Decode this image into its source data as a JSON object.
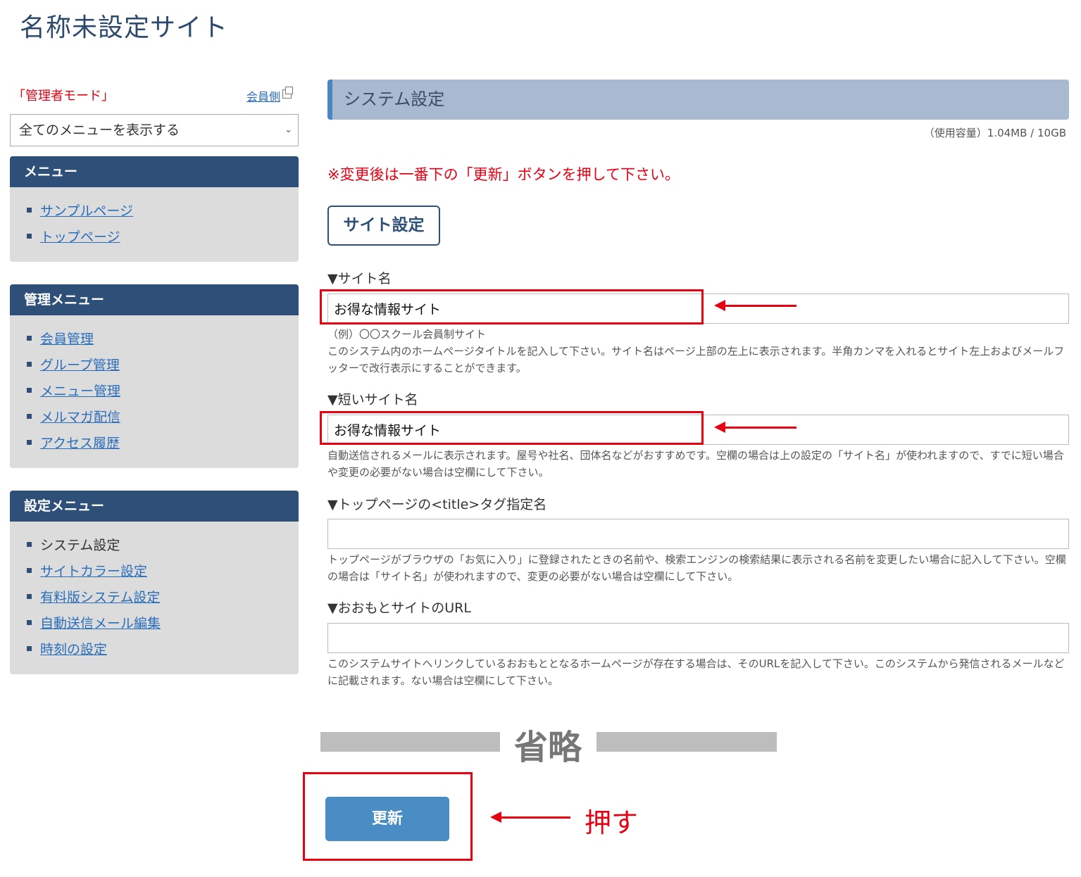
{
  "header": {
    "site_title": "名称未設定サイト"
  },
  "sidebar": {
    "admin_mode": "「管理者モード」",
    "member_link": "会員側",
    "menu_select_value": "全てのメニューを表示する",
    "menu": {
      "title": "メニュー",
      "items": [
        "サンプルページ",
        "トップページ"
      ]
    },
    "admin_menu": {
      "title": "管理メニュー",
      "items": [
        "会員管理",
        "グループ管理",
        "メニュー管理",
        "メルマガ配信",
        "アクセス履歴"
      ]
    },
    "settings_menu": {
      "title": "設定メニュー",
      "current": "システム設定",
      "items": [
        "サイトカラー設定",
        "有料版システム設定",
        "自動送信メール編集",
        "時刻の設定"
      ]
    }
  },
  "main": {
    "section_title": "システム設定",
    "usage": "（使用容量）1.04MB / 10GB",
    "notice": "※変更後は一番下の「更新」ボタンを押して下さい。",
    "tab_label": "サイト設定",
    "fields": {
      "site_name": {
        "label": "▼サイト名",
        "value": "お得な情報サイト",
        "example": "（例）〇〇スクール会員制サイト",
        "help": "このシステム内のホームページタイトルを記入して下さい。サイト名はページ上部の左上に表示されます。半角カンマを入れるとサイト左上およびメールフッターで改行表示にすることができます。"
      },
      "short_name": {
        "label": "▼短いサイト名",
        "value": "お得な情報サイト",
        "help": "自動送信されるメールに表示されます。屋号や社名、団体名などがおすすめです。空欄の場合は上の設定の「サイト名」が使われますので、すでに短い場合や変更の必要がない場合は空欄にして下さい。"
      },
      "top_title": {
        "label": "▼トップページの<title>タグ指定名",
        "value": "",
        "help": "トップページがブラウザの「お気に入り」に登録されたときの名前や、検索エンジンの検索結果に表示される名前を変更したい場合に記入して下さい。空欄の場合は「サイト名」が使われますので、変更の必要がない場合は空欄にして下さい。"
      },
      "main_url": {
        "label": "▼おおもとサイトのURL",
        "value": "",
        "help": "このシステムサイトへリンクしているおおもととなるホームページが存在する場合は、そのURLを記入して下さい。このシステムから発信されるメールなどに記載されます。ない場合は空欄にして下さい。"
      }
    },
    "omitted": "省略",
    "update_button": "更新",
    "push_label": "押す"
  }
}
